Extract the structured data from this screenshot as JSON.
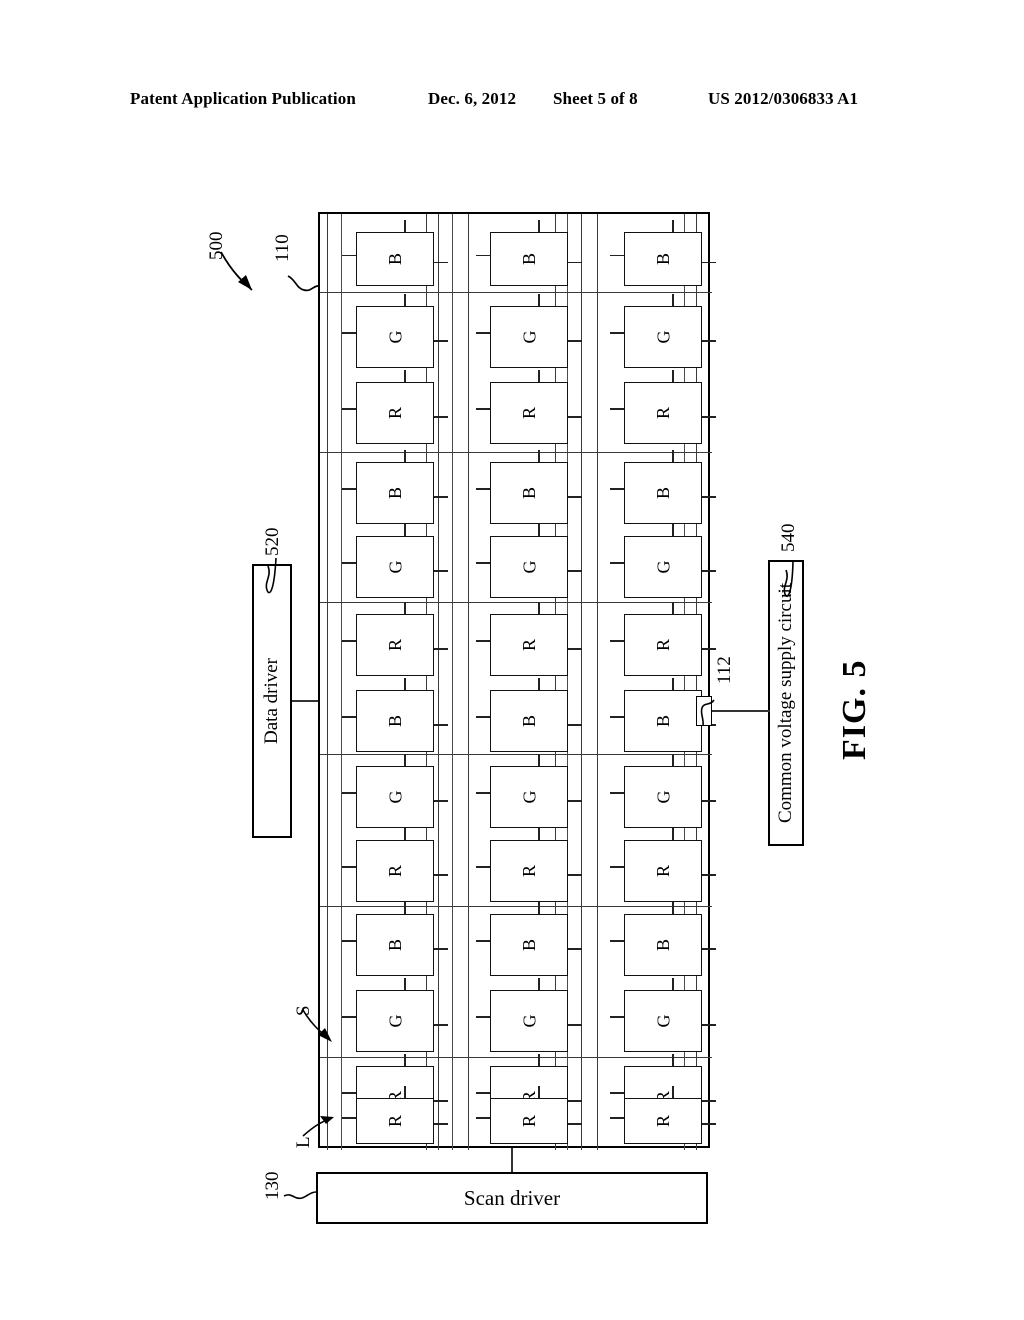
{
  "header": {
    "publication": "Patent Application Publication",
    "date": "Dec. 6, 2012",
    "sheet": "Sheet 5 of 8",
    "patent_number": "US 2012/0306833 A1"
  },
  "figure": {
    "label": "FIG. 5",
    "device_ref": "500"
  },
  "blocks": {
    "data_driver": {
      "label": "Data driver",
      "ref": "520"
    },
    "scan_driver": {
      "label": "Scan driver",
      "ref": "130"
    },
    "common_voltage": {
      "label": "Common voltage supply circuit",
      "ref": "540"
    }
  },
  "callouts": {
    "pixel_array": "110",
    "common_electrode_tab": "112",
    "scan_line": "S",
    "data_line": "L"
  },
  "panel": {
    "columns": 3,
    "subpixel_sequence": [
      "B",
      "G",
      "R",
      "B",
      "G",
      "R",
      "B",
      "G",
      "R",
      "B",
      "G",
      "R",
      "R"
    ],
    "column_subpixels": [
      [
        "B",
        "G",
        "R",
        "B",
        "G",
        "R",
        "B",
        "G",
        "R",
        "B",
        "G",
        "R",
        "R"
      ],
      [
        "B",
        "G",
        "R",
        "B",
        "G",
        "R",
        "B",
        "G",
        "R",
        "B",
        "G",
        "R",
        "R"
      ],
      [
        "B",
        "G",
        "R",
        "B",
        "G",
        "R",
        "B",
        "G",
        "R",
        "B",
        "G",
        "R",
        "R"
      ]
    ],
    "subpixel_labels": {
      "red": "R",
      "green": "G",
      "blue": "B"
    }
  },
  "colors": {
    "ink": "#000000",
    "line": "#333333",
    "background": "#ffffff"
  }
}
